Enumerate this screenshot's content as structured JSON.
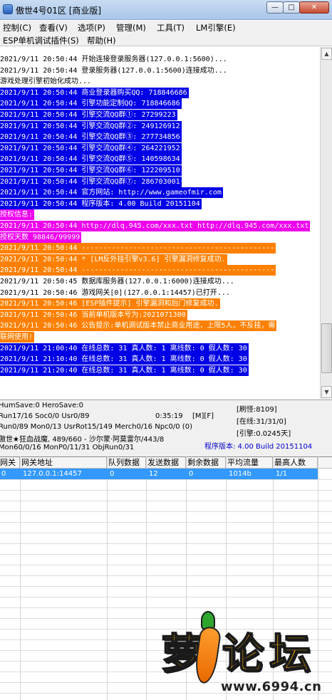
{
  "window": {
    "title": "傲世4号01区 [商业版]",
    "min_symbol": "—",
    "max_symbol": "□",
    "close_symbol": "✕"
  },
  "menu": {
    "row1": [
      "控制(C)",
      "查看(V)",
      "选项(P)",
      "管理(M)",
      "工具(T)",
      "LM引擎(E)"
    ],
    "row2": [
      "ESP单机调试插件(S)",
      "帮助(H)"
    ]
  },
  "log": [
    {
      "text": "2021/9/11 20:50:44 开始连接登录服务器(127.0.0.1:5600)...",
      "style": "plain"
    },
    {
      "text": "2021/9/11 20:50:44 登录服务器(127.0.0.1:5600)连接成功...",
      "style": "plain"
    },
    {
      "text": "游戏处理引擎初始化成功...",
      "style": "plain"
    },
    {
      "text": "2021/9/11 20:50:44 商业登录器购买QQ: 718846686",
      "style": "blue"
    },
    {
      "text": "2021/9/11 20:50:44 引擎功能定制QQ: 718846686",
      "style": "blue"
    },
    {
      "text": "2021/9/11 20:50:44 引擎交流QQ群①: 27299223",
      "style": "blue"
    },
    {
      "text": "2021/9/11 20:50:44 引擎交流QQ群②: 249126912",
      "style": "blue"
    },
    {
      "text": "2021/9/11 20:50:44 引擎交流QQ群③: 277734856",
      "style": "blue"
    },
    {
      "text": "2021/9/11 20:50:44 引擎交流QQ群④: 264221952",
      "style": "blue"
    },
    {
      "text": "2021/9/11 20:50:44 引擎交流QQ群⑤: 140598634",
      "style": "blue"
    },
    {
      "text": "2021/9/11 20:50:44 引擎交流QQ群⑥: 122209510",
      "style": "blue"
    },
    {
      "text": "2021/9/11 20:50:44 引擎交流QQ群⑦: 286703001",
      "style": "blue"
    },
    {
      "text": "2021/9/11 20:50:44 官方网站: http://www.gameofmir.com",
      "style": "blue"
    },
    {
      "text": "2021/9/11 20:50:44 程序版本: 4.00 Build 20151104",
      "style": "blue"
    },
    {
      "text": "授权信息:",
      "style": "magenta"
    },
    {
      "text": "2021/9/11 20:50:44 http://dlq.945.com/xxx.txt http://dlq.945.com/xxx.txt",
      "style": "magenta"
    },
    {
      "text": "授权天数 98846/99999",
      "style": "magenta"
    },
    {
      "text": "2021/9/11 20:50:44 ---------------------------------------------",
      "style": "orange"
    },
    {
      "text": "2021/9/11 20:50:44 * [LM反外挂引擎v3.6] 引擎漏洞修复成功.",
      "style": "orange"
    },
    {
      "text": "2021/9/11 20:50:44 ---------------------------------------------",
      "style": "orange"
    },
    {
      "text": "2021/9/11 20:50:45 数据库服务器(127.0.0.1:6000)连接成功...",
      "style": "plain"
    },
    {
      "text": "2021/9/11 20:50:46 游戏网关[0](127.0.0.1:14457)已打开...",
      "style": "plain"
    },
    {
      "text": "2021/9/11 20:50:46 [ESP插件提示] 引擎漏洞和后门修复成功.",
      "style": "orange"
    },
    {
      "text": "2021/9/11 20:50:46 当前单机版本号为:2021071300",
      "style": "orange"
    },
    {
      "text": "2021/9/11 20:50:46 公告提示:单机调试版本禁止商业用途，上限5人，不反挂，需",
      "style": "orange"
    },
    {
      "text": "联网使用!",
      "style": "orange"
    },
    {
      "text": "2021/9/11 21:00:40 在线总数: 31 真人数: 1 离线数: 0 假人数: 30",
      "style": "blue"
    },
    {
      "text": "2021/9/11 21:10:40 在线总数: 31 真人数: 1 离线数: 0 假人数: 30",
      "style": "blue"
    },
    {
      "text": "2021/9/11 21:20:40 在线总数: 31 真人数: 1 离线数: 0 假人数: 30",
      "style": "blue"
    }
  ],
  "status": {
    "line1": "HumSave:0 HeroSave:0",
    "line2": "Run17/16 Soc0/0 Usr0/89",
    "timer": "0:35:19",
    "flags": "[M][F]",
    "line3": "Run0/89 Mon0/13 UsrRot15/149 Merch0/16 Npc0/0 (0)",
    "line4": "傲世★狂血战魔, 489/660 - 沙尔蒙·阿莫雷尔/443/8",
    "line5": "Mon60/0/16 MonP0/11/31 ObjRun0/31",
    "refresh": "[刷怪:8109]",
    "online": "[在线:31/31/0]",
    "engine": "[引擎:0.0245天]",
    "version": "程序版本: 4.00 Build 20151104"
  },
  "table": {
    "headers": [
      "网关",
      "网关地址",
      "队列数据",
      "发送数据",
      "剩余数据",
      "平均流量",
      "最高人数"
    ],
    "rows": [
      [
        "0",
        "127.0.0.1:14457",
        "0",
        "12",
        "0",
        "1014b",
        "1/1"
      ]
    ]
  },
  "watermark": {
    "chars": [
      "萝",
      "论",
      "坛"
    ],
    "url": "www.6994.cn"
  }
}
